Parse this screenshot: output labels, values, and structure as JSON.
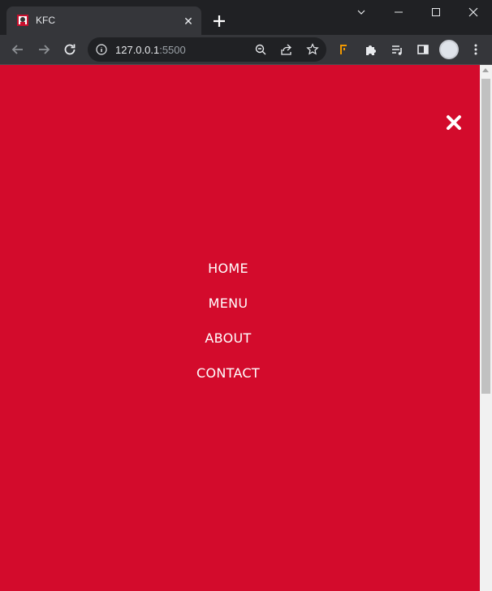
{
  "browser": {
    "tab": {
      "title": "KFC"
    },
    "url": {
      "host": "127.0.0.1",
      "port": ":5500"
    }
  },
  "page": {
    "nav": [
      "HOME",
      "MENU",
      "ABOUT",
      "CONTACT"
    ]
  },
  "colors": {
    "page_background": "#d30b2c",
    "nav_text": "#ffffff"
  }
}
